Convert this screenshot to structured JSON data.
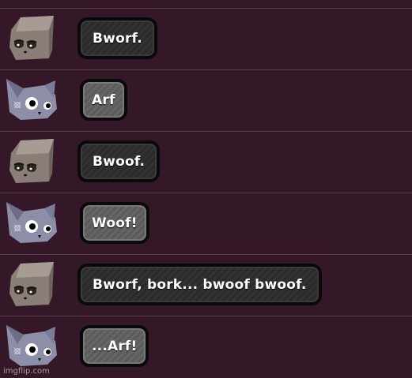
{
  "messages": [
    {
      "speaker": "cube-dog",
      "text": "Bworf."
    },
    {
      "speaker": "grey-cat",
      "text": "Arf"
    },
    {
      "speaker": "cube-dog",
      "text": "Bwoof."
    },
    {
      "speaker": "grey-cat",
      "text": "Woof!"
    },
    {
      "speaker": "cube-dog",
      "text": "Bworf, bork... bwoof bwoof."
    },
    {
      "speaker": "grey-cat",
      "text": "...Arf!"
    }
  ],
  "watermark": "imgflip.com",
  "colors": {
    "background": "#341827",
    "divider": "#5a3a4c",
    "bubble_dark": "#2a2a2a",
    "bubble_grey": "#5b5b5b",
    "bubble_border": "#0a0a0a",
    "text": "#ffffff"
  }
}
